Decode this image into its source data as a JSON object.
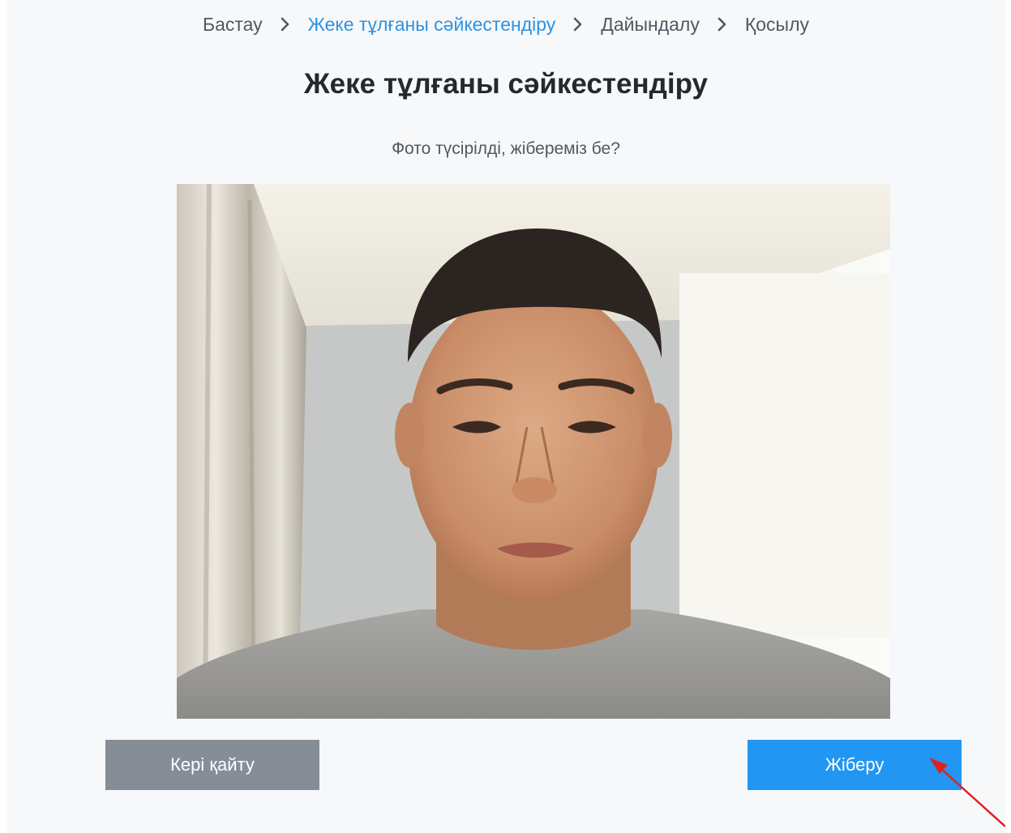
{
  "breadcrumb": {
    "items": [
      "Бастау",
      "Жеке тұлғаны сәйкестендіру",
      "Дайындалу",
      "Қосылу"
    ],
    "active_index": 1,
    "separator_icon": "chevron-right-icon"
  },
  "page_title": "Жеке тұлғаны сәйкестендіру",
  "subtitle": "Фото түсірілді, жібереміз бе?",
  "actions": {
    "back_label": "Кері қайту",
    "send_label": "Жіберу"
  },
  "colors": {
    "accent": "#2196f3",
    "active_crumb": "#2c93e3",
    "secondary_button": "#878d97",
    "annotation_arrow": "#e02020"
  }
}
